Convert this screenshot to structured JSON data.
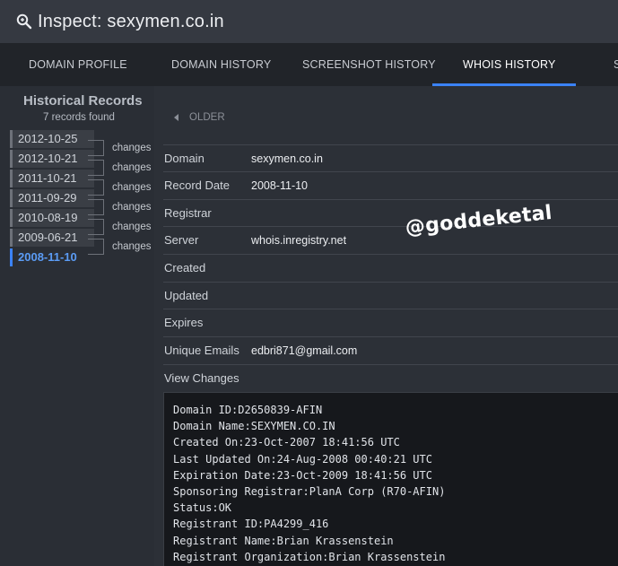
{
  "header": {
    "title": "Inspect: sexymen.co.in",
    "icon": "search-icon"
  },
  "tabs": [
    {
      "label": "DOMAIN PROFILE",
      "active": false
    },
    {
      "label": "DOMAIN HISTORY",
      "active": false
    },
    {
      "label": "SCREENSHOT HISTORY",
      "active": false
    },
    {
      "label": "WHOIS HISTORY",
      "active": true
    },
    {
      "label": "S",
      "active": false
    }
  ],
  "colors": {
    "accent": "#3b82f6",
    "background": "#2a2e35",
    "code_background": "#16181c"
  },
  "sidebar": {
    "heading": "Historical Records",
    "count": "7 records found",
    "dates": [
      {
        "label": "2012-10-25",
        "active": false
      },
      {
        "label": "2012-10-21",
        "active": false
      },
      {
        "label": "2011-10-21",
        "active": false
      },
      {
        "label": "2011-09-29",
        "active": false
      },
      {
        "label": "2010-08-19",
        "active": false
      },
      {
        "label": "2009-06-21",
        "active": false
      },
      {
        "label": "2008-11-10",
        "active": true
      }
    ],
    "changes_label": "changes"
  },
  "main": {
    "older_label": "OLDER",
    "fields": [
      {
        "label": "Domain",
        "value": "sexymen.co.in"
      },
      {
        "label": "Record Date",
        "value": "2008-11-10"
      },
      {
        "label": "Registrar",
        "value": ""
      },
      {
        "label": "Server",
        "value": "whois.inregistry.net"
      },
      {
        "label": "Created",
        "value": ""
      },
      {
        "label": "Updated",
        "value": ""
      },
      {
        "label": "Expires",
        "value": ""
      },
      {
        "label": "Unique Emails",
        "value": "edbri871@gmail.com"
      },
      {
        "label": "View Changes",
        "value": ""
      }
    ],
    "raw_whois": [
      "Domain ID:D2650839-AFIN",
      "Domain Name:SEXYMEN.CO.IN",
      "Created On:23-Oct-2007 18:41:56 UTC",
      "Last Updated On:24-Aug-2008 00:40:21 UTC",
      "Expiration Date:23-Oct-2009 18:41:56 UTC",
      "Sponsoring Registrar:PlanA Corp (R70-AFIN)",
      "Status:OK",
      "Registrant ID:PA4299_416",
      "Registrant Name:Brian Krassenstein",
      "Registrant Organization:Brian Krassenstein"
    ]
  },
  "watermark": "@goddeketal"
}
